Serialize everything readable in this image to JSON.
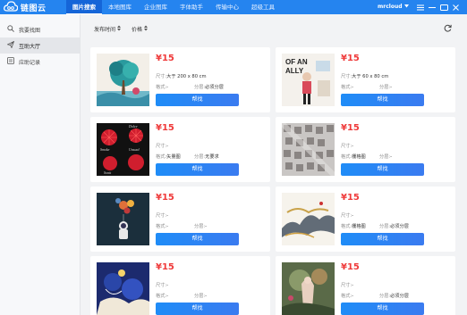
{
  "app": {
    "name": "链图云"
  },
  "nav": {
    "items": [
      {
        "label": "图片搜索",
        "active": true
      },
      {
        "label": "本地图库",
        "active": false
      },
      {
        "label": "企业图库",
        "active": false
      },
      {
        "label": "字体助手",
        "active": false
      },
      {
        "label": "传输中心",
        "active": false
      },
      {
        "label": "超级工具",
        "active": false
      }
    ]
  },
  "user": {
    "name": "mrcloud"
  },
  "sidebar": {
    "items": [
      {
        "label": "我要找图",
        "icon": "search-icon",
        "active": false
      },
      {
        "label": "互助大厅",
        "icon": "send-icon",
        "active": true
      },
      {
        "label": "应助记录",
        "icon": "list-icon",
        "active": false
      }
    ]
  },
  "filters": {
    "time_label": "发布时间",
    "price_label": "价格"
  },
  "labels": {
    "size": "尺寸:",
    "format": "格式:",
    "layer": "分层:",
    "button": "帮找"
  },
  "cards": [
    {
      "price": "¥15",
      "size": "大于 200 x 80 cm",
      "format": "-",
      "layer": "必须分层",
      "thumb": "tree"
    },
    {
      "price": "¥15",
      "size": "大于 60 x 80 cm",
      "format": "-",
      "layer": "-",
      "thumb": "poster"
    },
    {
      "price": "¥15",
      "size": "-",
      "format": "矢量图",
      "layer": "无要求",
      "thumb": "flowers"
    },
    {
      "price": "¥15",
      "size": "-",
      "format": "栅格图",
      "layer": "-",
      "thumb": "pattern"
    },
    {
      "price": "¥15",
      "size": "-",
      "format": "-",
      "layer": "-",
      "thumb": "astronaut"
    },
    {
      "price": "¥15",
      "size": "-",
      "format": "栅格图",
      "layer": "必须分层",
      "thumb": "ink"
    },
    {
      "price": "¥15",
      "size": "-",
      "format": "-",
      "layer": "-",
      "thumb": "blue"
    },
    {
      "price": "¥15",
      "size": "-",
      "format": "-",
      "layer": "必须分层",
      "thumb": "fantasy"
    }
  ],
  "colors": {
    "titlebar": "#2584ef",
    "price": "#ef3a3a",
    "button": "#1f8cf7"
  }
}
